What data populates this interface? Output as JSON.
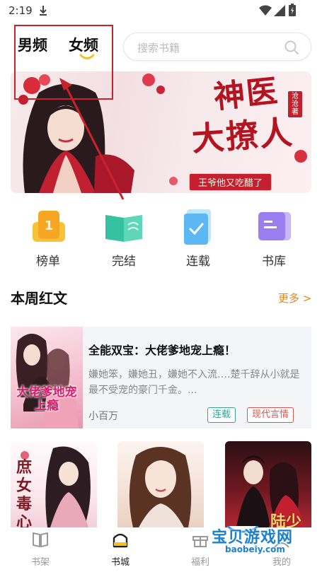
{
  "status_bar": {
    "time": "2:19"
  },
  "header": {
    "tabs": [
      {
        "label": "男频"
      },
      {
        "label": "女频",
        "active": true
      }
    ],
    "search_placeholder": "搜索书籍"
  },
  "banner": {
    "title_line1": "神医",
    "title_line2": "大撩人",
    "author": "沧沧著",
    "tagline": "王爷他又吃醋了"
  },
  "categories": [
    {
      "label": "榜单",
      "icon": "trophy-icon"
    },
    {
      "label": "完结",
      "icon": "open-book-icon"
    },
    {
      "label": "连载",
      "icon": "document-check-icon"
    },
    {
      "label": "书库",
      "icon": "library-icon"
    }
  ],
  "weekly_section": {
    "title": "本周红文",
    "more_label": "更多 >"
  },
  "featured_book": {
    "title": "全能双宝：大佬爹地宠上瘾！",
    "description": "嫌她笨，嫌她丑，嫌她不入流….楚千辞从小就是最不受宠的豪门千金。...",
    "author": "小百万",
    "tags": [
      "连载",
      "现代言情"
    ],
    "cover_text": "大佬爹地宠上瘾"
  },
  "grid_books": [
    {
      "cover_text": "庶女毒心"
    },
    {
      "cover_text": ""
    },
    {
      "cover_text": "陆少"
    }
  ],
  "watermark": {
    "text": "宝贝游戏网",
    "url": "baobeiy.com"
  },
  "bottom_nav": [
    {
      "label": "书架",
      "icon": "bookshelf-icon"
    },
    {
      "label": "书城",
      "icon": "bookstore-icon",
      "active": true
    },
    {
      "label": "福利",
      "icon": "gift-icon"
    },
    {
      "label": "我的",
      "icon": "profile-icon"
    }
  ],
  "colors": {
    "accent_orange": "#e2891b",
    "tab_indicator": "#f3c316",
    "highlight_red": "#c8232c",
    "tag_serial": "#3aa393",
    "tag_genre": "#d9534f"
  }
}
